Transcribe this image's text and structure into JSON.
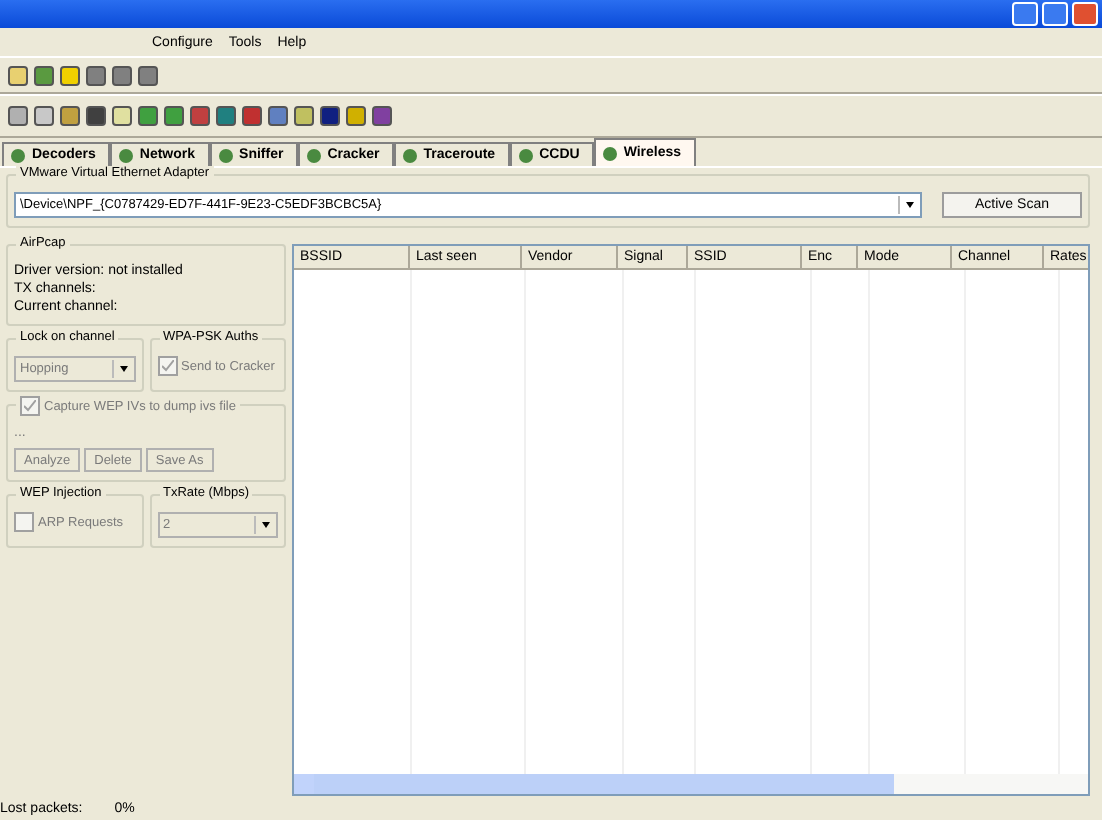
{
  "menu": [
    "Configure",
    "Tools",
    "Help"
  ],
  "tabs": [
    {
      "label": "Decoders",
      "selected": false
    },
    {
      "label": "Network",
      "selected": false
    },
    {
      "label": "Sniffer",
      "selected": false
    },
    {
      "label": "Cracker",
      "selected": false
    },
    {
      "label": "Traceroute",
      "selected": false
    },
    {
      "label": "CCDU",
      "selected": false
    },
    {
      "label": "Wireless",
      "selected": true
    }
  ],
  "adapter": {
    "label": "VMware Virtual Ethernet Adapter",
    "value": "\\Device\\NPF_{C0787429-ED7F-441F-9E23-C5EDF3BCBC5A}",
    "button": "Active Scan"
  },
  "airpcap": {
    "label": "AirPcap",
    "lines": [
      "Driver version: not installed",
      "TX channels:",
      "Current channel:"
    ]
  },
  "lock": {
    "label": "Lock on channel",
    "value": "Hopping",
    "disabled": true
  },
  "wpa": {
    "label": "WPA-PSK Auths",
    "checkbox": "Send to Cracker",
    "checked": true,
    "disabled": true
  },
  "capture": {
    "label": "Capture WEP IVs to dump ivs file",
    "checked": true,
    "disabled": true,
    "path": "...",
    "buttons": [
      "Analyze",
      "Delete",
      "Save As"
    ]
  },
  "injection": {
    "label": "WEP Injection",
    "checkbox": "ARP Requests",
    "checked": false,
    "disabled": true
  },
  "txrate": {
    "label": "TxRate (Mbps)",
    "value": "2",
    "disabled": true
  },
  "table": {
    "columns": [
      "BSSID",
      "Last seen",
      "Vendor",
      "Signal",
      "SSID",
      "Enc",
      "Mode",
      "Channel",
      "Rates"
    ]
  },
  "status": {
    "label": "Lost packets:",
    "value": "0%"
  }
}
